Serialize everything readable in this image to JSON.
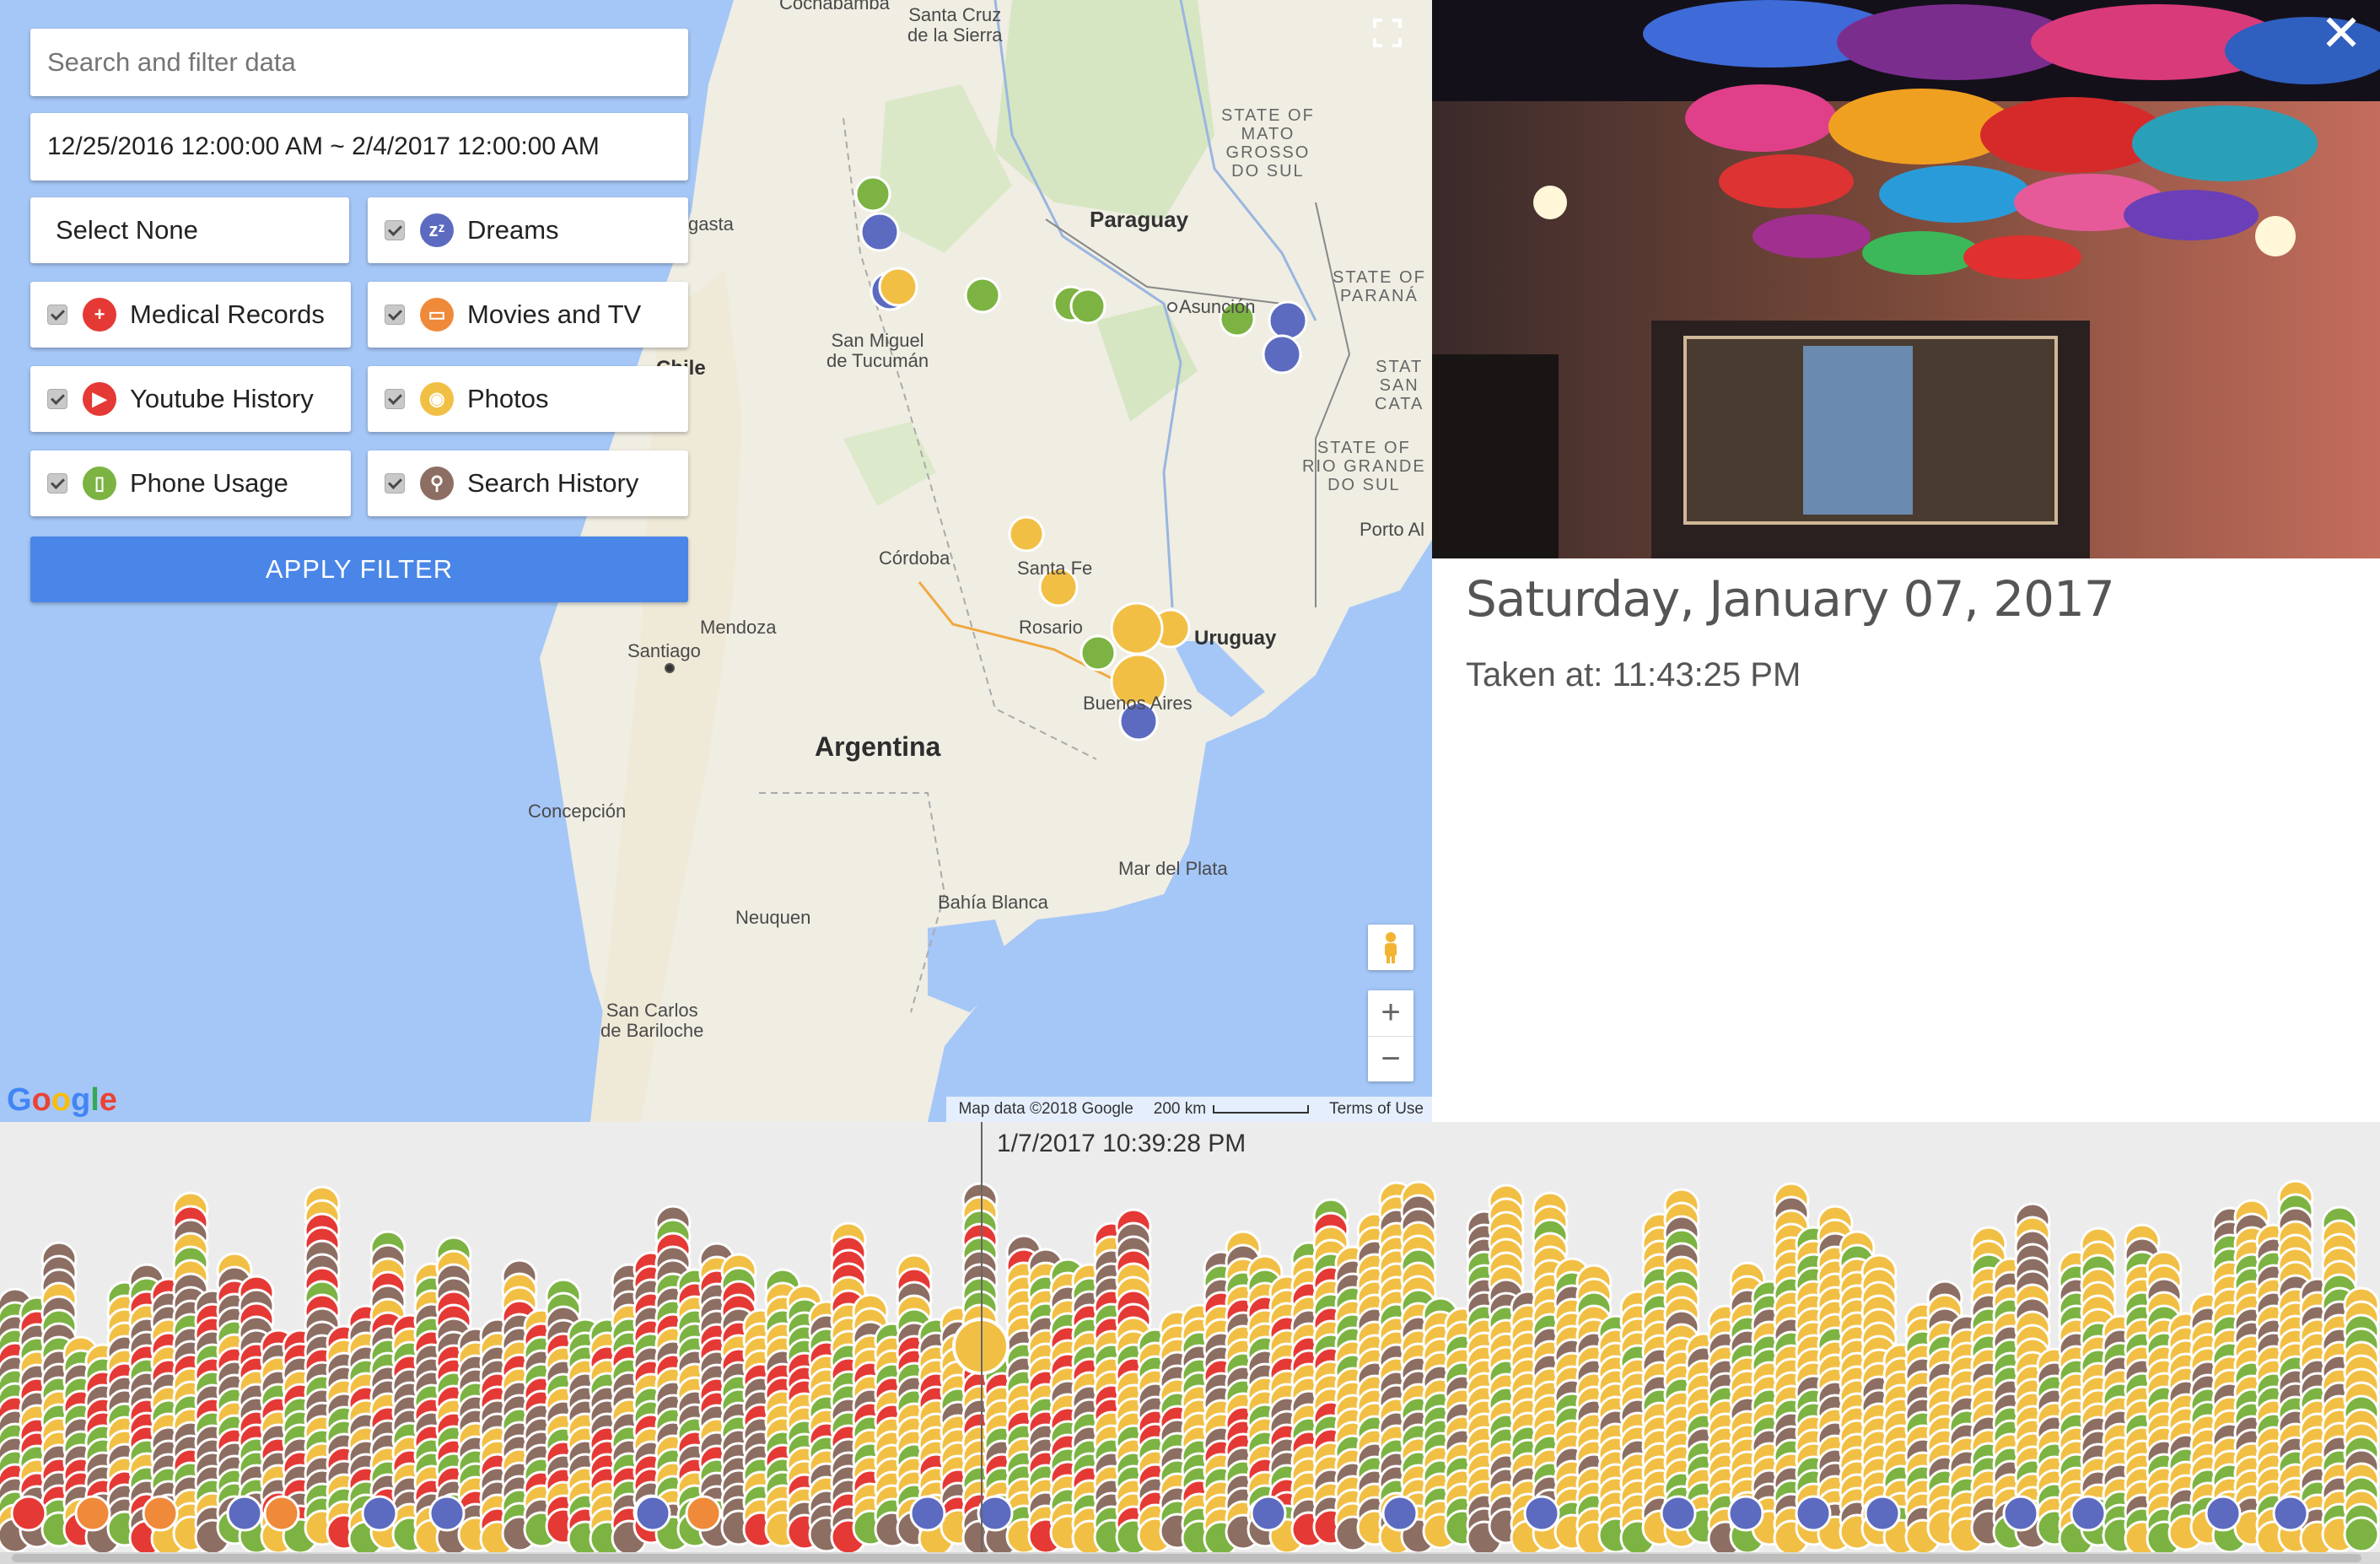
{
  "filter": {
    "search_placeholder": "Search and filter data",
    "date_range": "12/25/2016 12:00:00 AM ~ 2/4/2017 12:00:00 AM",
    "select_none_label": "Select None",
    "categories": [
      {
        "label": "Dreams",
        "icon": "dreams-icon",
        "glyph": "zᶻ",
        "color": "#5c6bc0",
        "checked": true
      },
      {
        "label": "Medical Records",
        "icon": "medical-cross-icon",
        "glyph": "+",
        "color": "#e53935",
        "checked": true
      },
      {
        "label": "Movies and TV",
        "icon": "tv-icon",
        "glyph": "▭",
        "color": "#ef8a3b",
        "checked": true
      },
      {
        "label": "Youtube History",
        "icon": "play-icon",
        "glyph": "▶",
        "color": "#e53935",
        "checked": true
      },
      {
        "label": "Photos",
        "icon": "camera-icon",
        "glyph": "◉",
        "color": "#f2bf45",
        "checked": true
      },
      {
        "label": "Phone Usage",
        "icon": "phone-icon",
        "glyph": "▯",
        "color": "#7cb342",
        "checked": true
      },
      {
        "label": "Search History",
        "icon": "magnifier-icon",
        "glyph": "⚲",
        "color": "#8d6e63",
        "checked": true
      }
    ],
    "apply_label": "APPLY FILTER"
  },
  "map": {
    "labels": {
      "santa_cruz": "Santa Cruz\nde la Sierra",
      "cochabamba": "Cochabamba",
      "mato_grosso": "STATE OF\nMATO\nGROSSO\nDO SUL",
      "paraguay": "Paraguay",
      "parana": "STATE OF\nPARANÁ",
      "santa_catarina": "STAT\nSAN\nCATA",
      "rio_grande": "STATE OF\nRIO GRANDE\nDO SUL",
      "porto_alegre": "Porto Al",
      "asuncion": "Asunción",
      "tucuman": "San Miguel\nde Tucumán",
      "gasta": "gasta",
      "chile": "Chile",
      "cordoba": "Córdoba",
      "santa_fe": "Santa Fe",
      "rosario": "Rosario",
      "uruguay": "Uruguay",
      "mendoza": "Mendoza",
      "santiago": "Santiago",
      "buenos_aires": "Buenos Aires",
      "argentina": "Argentina",
      "concepcion": "Concepción",
      "mar_del_plata": "Mar del Plata",
      "bahia_blanca": "Bahía Blanca",
      "neuquen": "Neuquen",
      "bariloche": "San Carlos\nde Bariloche"
    },
    "footer": {
      "map_data": "Map data ©2018 Google",
      "scale": "200 km",
      "terms": "Terms of Use"
    },
    "logo": "Google"
  },
  "detail": {
    "date": "Saturday, January 07, 2017",
    "time": "Taken at: 11:43:25 PM"
  },
  "timeline": {
    "cursor_time": "1/7/2017 10:39:28 PM"
  },
  "colors": {
    "photos": "#f2bf45",
    "phone": "#7cb342",
    "search": "#8d6e63",
    "youtube": "#e53935",
    "dreams": "#5c6bc0",
    "tv": "#ef8a3b",
    "accent": "#4a86e8"
  }
}
